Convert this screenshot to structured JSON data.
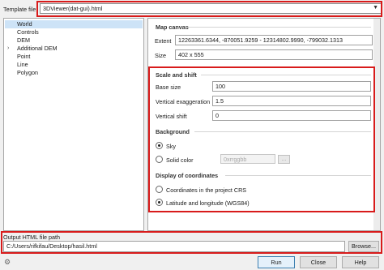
{
  "template": {
    "label": "Template file",
    "value": "3DViewer(dat-gui).html"
  },
  "tree": {
    "items": [
      {
        "label": "World",
        "selected": true
      },
      {
        "label": "Controls"
      },
      {
        "label": "DEM"
      },
      {
        "label": "Additional DEM",
        "expandable": true
      },
      {
        "label": "Point"
      },
      {
        "label": "Line"
      },
      {
        "label": "Polygon"
      }
    ]
  },
  "map_canvas": {
    "title": "Map canvas",
    "extent_label": "Extent",
    "extent_value": "12263361.6344, -870051.9259 - 12314802.9990, -799032.1313",
    "size_label": "Size",
    "size_value": "402 x 555"
  },
  "scale_shift": {
    "title": "Scale and shift",
    "base_size_label": "Base size",
    "base_size_value": "100",
    "vert_exag_label": "Vertical exaggeration",
    "vert_exag_value": "1.5",
    "vert_shift_label": "Vertical shift",
    "vert_shift_value": "0"
  },
  "background": {
    "title": "Background",
    "sky_label": "Sky",
    "sky_selected": true,
    "solid_label": "Solid color",
    "solid_placeholder": "0xrrggbb",
    "color_button_label": "..."
  },
  "coords": {
    "title": "Display of coordinates",
    "crs_label": "Coordinates in the project CRS",
    "wgs_label": "Latitude and longitude (WGS84)",
    "wgs_selected": true
  },
  "output": {
    "label": "Output HTML file path",
    "value": "C:/Users/rifkifau/Desktop/hasil.html",
    "browse_label": "Browse..."
  },
  "buttons": {
    "run": "Run",
    "close": "Close",
    "help": "Help"
  },
  "colors": {
    "highlight": "#d81b1b",
    "selection": "#cde3f7"
  }
}
